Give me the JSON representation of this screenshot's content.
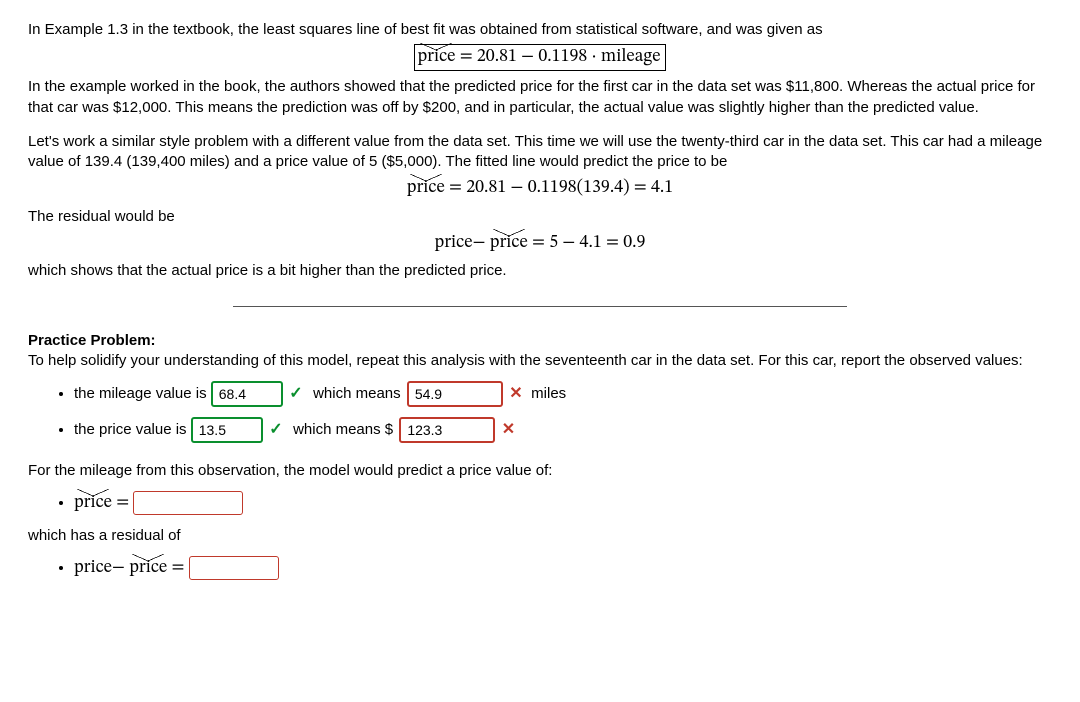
{
  "intro": {
    "p1a": "In Example 1.3 in the textbook, the least squares line of best fit was obtained from statistical software, and was given as",
    "eq1_lhs": "price",
    "eq1_rhs": " = 20.81 − 0.1198 · mileage",
    "p2": "In the example worked in the book, the authors showed that the predicted price for the first car in the data set was $11,800.  Whereas the actual price for that car was $12,000.  This means the prediction was off by $200, and in particular, the actual value was slightly higher than the predicted value.",
    "p3": "Let's work a similar style problem with a different value from the data set.  This time we will use the twenty-third car in the data set.  This car had a mileage value of 139.4 (139,400 miles) and a price value of 5 ($5,000).  The fitted line would predict the price to be",
    "eq2_lhs": "price",
    "eq2_rhs": " = 20.81 − 0.1198(139.4) = 4.1",
    "p4": "The residual would be",
    "eq3_a": "price",
    "eq3_mid": "−",
    "eq3_b": "price",
    "eq3_rhs": " = 5 − 4.1 = 0.9",
    "p5": "which shows that the actual price is a bit higher than the predicted price."
  },
  "practice": {
    "heading": "Practice Problem:",
    "lead": "To help solidify your understanding of this model, repeat this analysis with the seventeenth car in the data set.  For this car, report the observed values:",
    "mileage_label": "the mileage value is ",
    "mileage_value": "68.4",
    "which_means": " which means ",
    "mileage_means_value": "54.9",
    "miles_unit": " miles",
    "price_label": "the price value is ",
    "price_value": "13.5",
    "which_means_dollar": " which means $",
    "price_means_value": "123.3",
    "predict_lead": "For the mileage from this observation, the model would predict a price value of:",
    "pred_lhs": "price",
    "pred_eq": " = ",
    "resid_lead": "which has a residual of",
    "resid_a": "price",
    "resid_mid": "−",
    "resid_b": "price",
    "resid_eq": " = "
  },
  "marks": {
    "check": "✓",
    "cross": "✕"
  }
}
